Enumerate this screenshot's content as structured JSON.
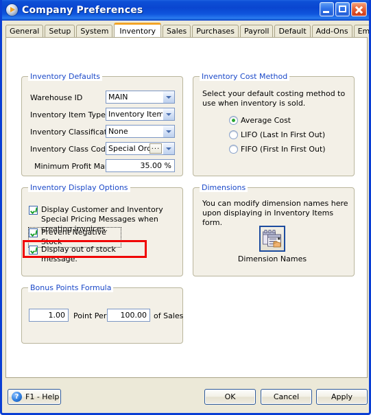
{
  "window": {
    "title": "Company Preferences",
    "icon": "app-play-circle-icon",
    "buttons": {
      "minimize": "Minimize",
      "maximize": "Maximize",
      "close": "Close"
    }
  },
  "tabs": [
    {
      "label": "General",
      "active": false
    },
    {
      "label": "Setup",
      "active": false
    },
    {
      "label": "System",
      "active": false
    },
    {
      "label": "Inventory",
      "active": true
    },
    {
      "label": "Sales",
      "active": false
    },
    {
      "label": "Purchases",
      "active": false
    },
    {
      "label": "Payroll",
      "active": false
    },
    {
      "label": "Default",
      "active": false
    },
    {
      "label": "Add-Ons",
      "active": false
    },
    {
      "label": "Email Setup",
      "active": false
    }
  ],
  "inventory_defaults": {
    "title": "Inventory Defaults",
    "fields": {
      "warehouse_id": {
        "label": "Warehouse ID",
        "value": "MAIN"
      },
      "inventory_item_type": {
        "label": "Inventory Item Type",
        "value": "Inventory Item"
      },
      "inventory_classification": {
        "label": "Inventory Classification",
        "value": "None"
      },
      "inventory_class_code": {
        "label": "Inventory Class Code",
        "value": "Special Order",
        "browse_label": "..."
      },
      "minimum_profit_margin": {
        "label": "Minimum Profit Margin",
        "value": "35.00 %"
      }
    }
  },
  "inventory_cost_method": {
    "title": "Inventory Cost Method",
    "description": "Select your default costing method to use when inventory is sold.",
    "options": [
      {
        "label": "Average Cost",
        "selected": true
      },
      {
        "label": "LIFO (Last In First Out)",
        "selected": false
      },
      {
        "label": "FIFO (First In First Out)",
        "selected": false
      }
    ]
  },
  "inventory_display_options": {
    "title": "Inventory Display Options",
    "options": [
      {
        "label": "Display Customer and Inventory Special Pricing Messages when creating invoices.",
        "checked": true,
        "focused": false,
        "highlighted": false
      },
      {
        "label": "Prevent Negative Stock",
        "checked": true,
        "focused": true,
        "highlighted": false
      },
      {
        "label": "Display out of stock message.",
        "checked": true,
        "focused": false,
        "highlighted": true
      }
    ],
    "highlight_color": "#f00000"
  },
  "dimensions": {
    "title": "Dimensions",
    "description": "You can modify dimension names here upon displaying in Inventory Items form.",
    "button": {
      "icon": "dimension-names-form-icon",
      "caption": "Dimension Names"
    }
  },
  "bonus_points_formula": {
    "title": "Bonus Points Formula",
    "points_value": "1.00",
    "middle_label": "Point Per",
    "amount_value": "100.00",
    "trailing_label": "of Sales"
  },
  "footer": {
    "help": {
      "label": "F1 - Help",
      "icon": "question-mark-icon"
    },
    "ok": "OK",
    "cancel": "Cancel",
    "apply": "Apply"
  },
  "theme": {
    "title_bar_blue": "#0a46d0",
    "accent_orange": "#f2a325",
    "group_label_blue": "#1a48c8",
    "check_green": "#19a02a",
    "face": "#ece9d8"
  }
}
